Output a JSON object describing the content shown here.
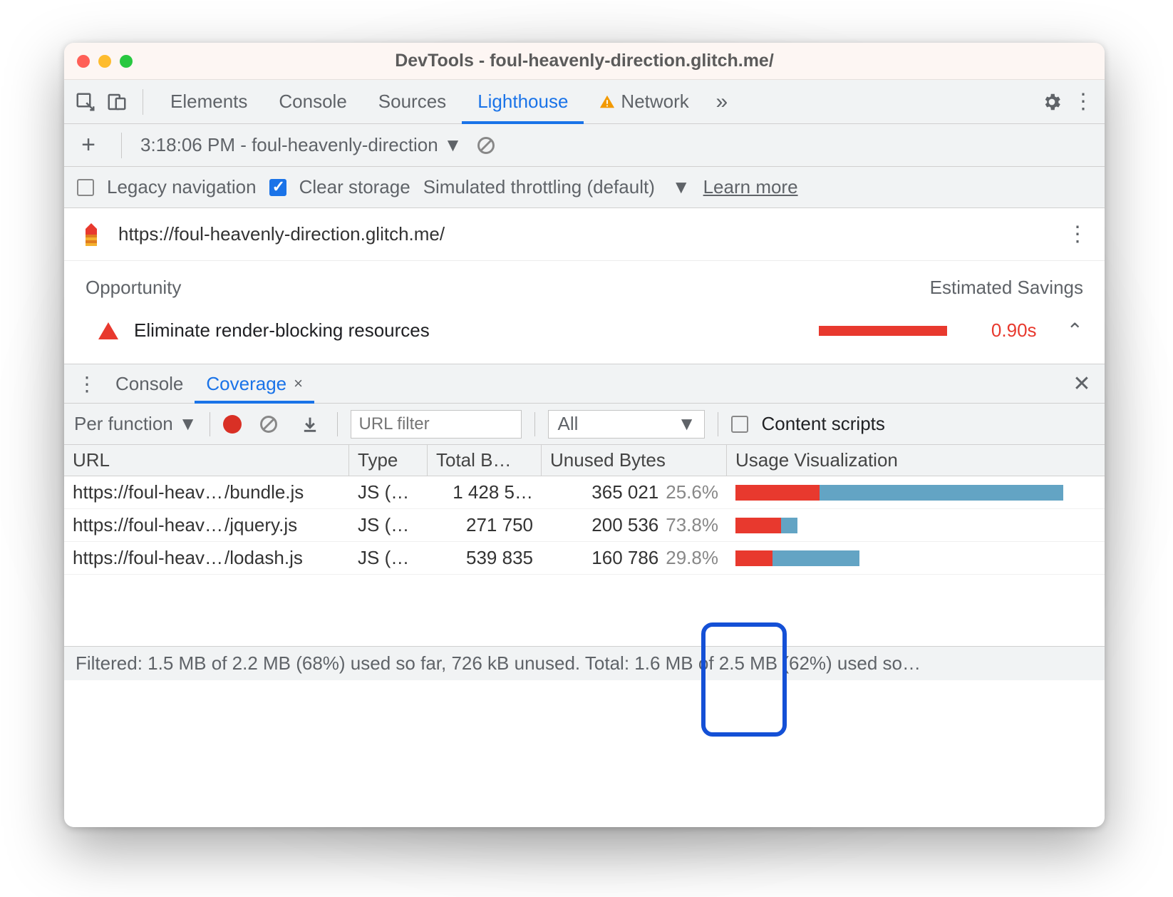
{
  "window": {
    "title": "DevTools - foul-heavenly-direction.glitch.me/"
  },
  "tabs": {
    "items": [
      "Elements",
      "Console",
      "Sources",
      "Lighthouse",
      "Network"
    ],
    "active": "Lighthouse"
  },
  "report_select": {
    "label": "3:18:06 PM - foul-heavenly-direction"
  },
  "options": {
    "legacy_nav": {
      "label": "Legacy navigation",
      "checked": false
    },
    "clear_storage": {
      "label": "Clear storage",
      "checked": true
    },
    "throttling": "Simulated throttling (default)",
    "learn_more": "Learn more"
  },
  "audit": {
    "url": "https://foul-heavenly-direction.glitch.me/",
    "opportunity_header": "Opportunity",
    "savings_header": "Estimated Savings",
    "item": {
      "title": "Eliminate render-blocking resources",
      "savings": "0.90s"
    }
  },
  "drawer": {
    "tabs": [
      "Console",
      "Coverage"
    ],
    "active": "Coverage"
  },
  "coverage_toolbar": {
    "mode": "Per function",
    "url_filter_placeholder": "URL filter",
    "type_filter": "All",
    "content_scripts": {
      "label": "Content scripts",
      "checked": false
    }
  },
  "coverage_table": {
    "headers": {
      "url": "URL",
      "type": "Type",
      "total": "Total B…",
      "unused": "Unused Bytes",
      "usage": "Usage Visualization"
    },
    "rows": [
      {
        "url_prefix": "https://foul-heav…",
        "url_suffix": "/bundle.js",
        "type": "JS (…",
        "total": "1 428 5…",
        "unused_bytes": "365 021",
        "unused_pct": "25.6%",
        "bar_red": 25.6,
        "bar_total": 100
      },
      {
        "url_prefix": "https://foul-heav…",
        "url_suffix": "/jquery.js",
        "type": "JS (…",
        "total": "271 750",
        "unused_bytes": "200 536",
        "unused_pct": "73.8%",
        "bar_red": 14.0,
        "bar_total": 19.0
      },
      {
        "url_prefix": "https://foul-heav…",
        "url_suffix": "/lodash.js",
        "type": "JS (…",
        "total": "539 835",
        "unused_bytes": "160 786",
        "unused_pct": "29.8%",
        "bar_red": 11.3,
        "bar_total": 37.8
      }
    ]
  },
  "status": "Filtered: 1.5 MB of 2.2 MB (68%) used so far, 726 kB unused. Total: 1.6 MB of 2.5 MB (62%) used so…"
}
